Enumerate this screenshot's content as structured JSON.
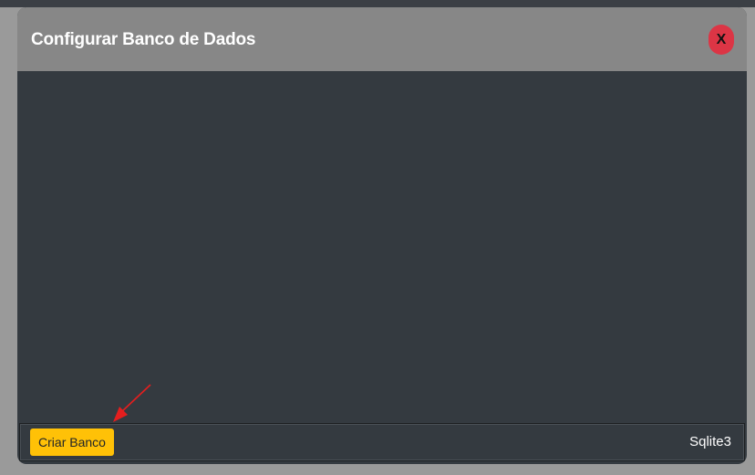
{
  "modal": {
    "title": "Configurar Banco de Dados",
    "close_label": "X"
  },
  "footer": {
    "create_button_label": "Criar Banco",
    "db_type": "Sqlite3"
  },
  "colors": {
    "header_bg": "#878787",
    "body_bg": "#343a40",
    "close_button": "#dc3545",
    "create_button": "#ffc107",
    "annotation_arrow": "#e41e1e"
  }
}
